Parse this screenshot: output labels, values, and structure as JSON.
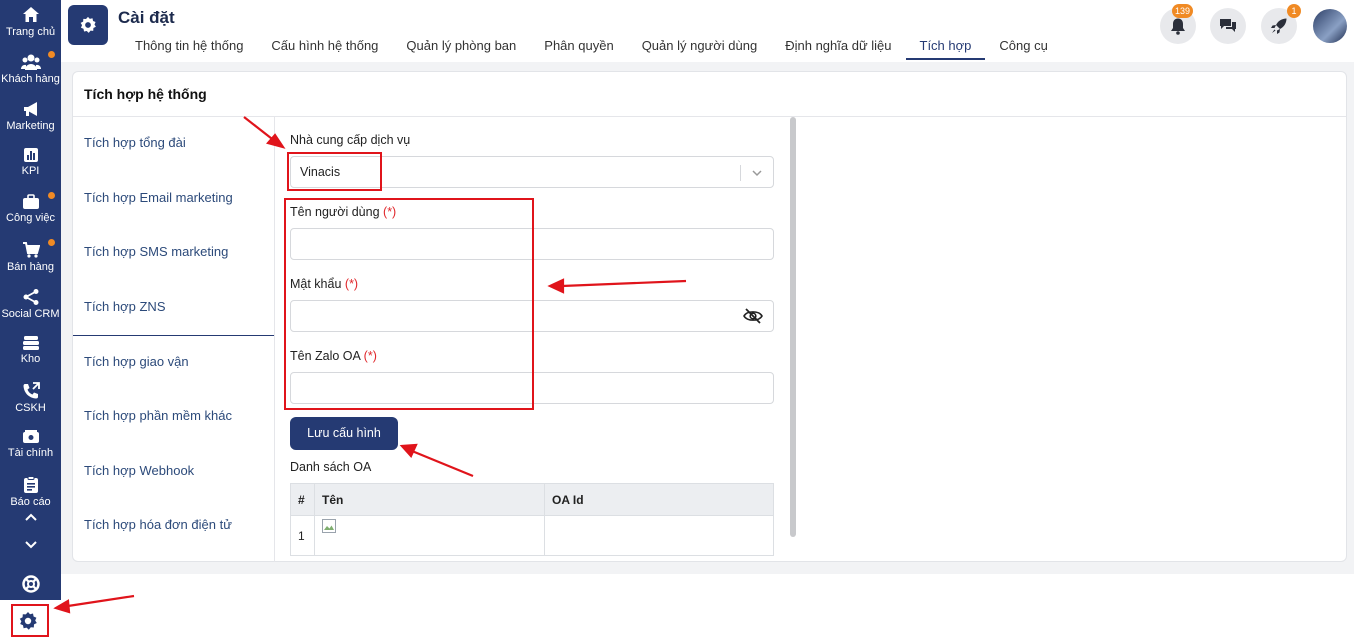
{
  "sidebar": {
    "items": [
      {
        "label": "Trang chủ",
        "icon": "home-icon",
        "dot": false
      },
      {
        "label": "Khách hàng",
        "icon": "users-icon",
        "dot": true
      },
      {
        "label": "Marketing",
        "icon": "megaphone-icon",
        "dot": false
      },
      {
        "label": "KPI",
        "icon": "chart-icon",
        "dot": false
      },
      {
        "label": "Công việc",
        "icon": "briefcase-icon",
        "dot": true
      },
      {
        "label": "Bán hàng",
        "icon": "cart-icon",
        "dot": true
      },
      {
        "label": "Social CRM",
        "icon": "share-icon",
        "dot": false
      },
      {
        "label": "Kho",
        "icon": "warehouse-icon",
        "dot": false
      },
      {
        "label": "CSKH",
        "icon": "phone-icon",
        "dot": false
      },
      {
        "label": "Tài chính",
        "icon": "money-icon",
        "dot": false
      },
      {
        "label": "Báo cáo",
        "icon": "clipboard-icon",
        "dot": false
      }
    ]
  },
  "header": {
    "title": "Cài đặt",
    "tabs": [
      "Thông tin hệ thống",
      "Cấu hình hệ thống",
      "Quản lý phòng ban",
      "Phân quyền",
      "Quản lý người dùng",
      "Định nghĩa dữ liệu",
      "Tích hợp",
      "Công cụ"
    ],
    "active_tab": "Tích hợp",
    "notification_count": "139",
    "rocket_count": "1"
  },
  "page": {
    "title": "Tích hợp hệ thống",
    "menu": [
      "Tích hợp tổng đài",
      "Tích hợp Email marketing",
      "Tích hợp SMS marketing",
      "Tích hợp ZNS",
      "Tích hợp giao vận",
      "Tích hợp phần mềm khác",
      "Tích hợp Webhook",
      "Tích hợp hóa đơn điện tử"
    ],
    "active_menu": "Tích hợp ZNS"
  },
  "form": {
    "provider_label": "Nhà cung cấp dịch vụ",
    "provider_value": "Vinacis",
    "username_label": "Tên người dùng",
    "password_label": "Mật khẩu",
    "zalo_oa_label": "Tên Zalo OA",
    "required_mark": "(*)",
    "username_value": "",
    "password_value": "",
    "zalo_oa_value": "",
    "save_label": "Lưu cấu hình",
    "oa_list_label": "Danh sách OA",
    "table": {
      "headers": [
        "#",
        "Tên",
        "OA Id"
      ],
      "rows": [
        [
          "1",
          "",
          ""
        ]
      ]
    }
  },
  "colors": {
    "primary": "#253a73",
    "accent": "#f08a24",
    "annotation": "#e0141b"
  }
}
